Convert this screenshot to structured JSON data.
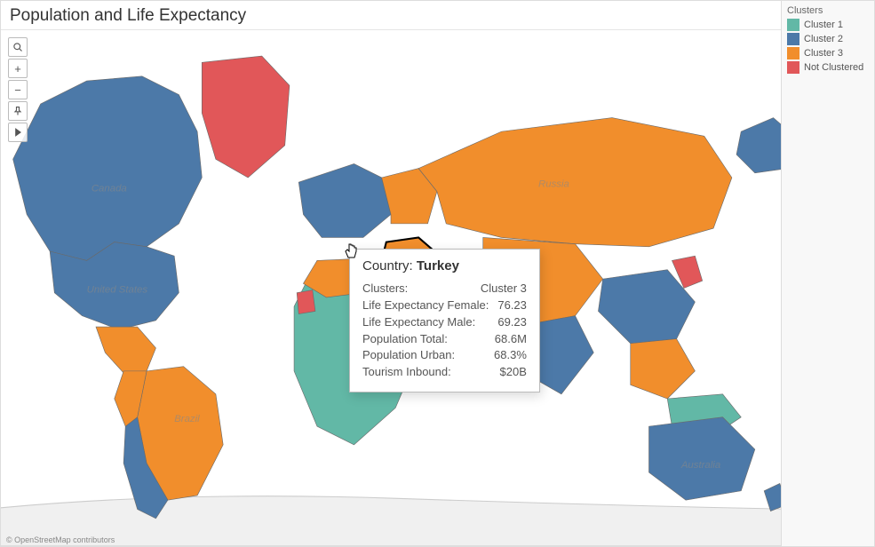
{
  "panel": {
    "title": "Population and Life Expectancy",
    "footer": "© OpenStreetMap contributors"
  },
  "toolbar": {
    "search": "search",
    "zoom_in": "+",
    "zoom_out": "−",
    "pin": "pin",
    "play": "▶"
  },
  "legend": {
    "title": "Clusters",
    "items": [
      {
        "label": "Cluster 1",
        "color": "#62b8a6"
      },
      {
        "label": "Cluster 2",
        "color": "#4c79a8"
      },
      {
        "label": "Cluster 3",
        "color": "#f18e2c"
      },
      {
        "label": "Not Clustered",
        "color": "#e15759"
      }
    ]
  },
  "tooltip": {
    "field_label": "Country:",
    "country": "Turkey",
    "rows": [
      {
        "label": "Clusters:",
        "value": "Cluster 3"
      },
      {
        "label": "Life Expectancy Female:",
        "value": "76.23"
      },
      {
        "label": "Life Expectancy Male:",
        "value": "69.23"
      },
      {
        "label": "Population Total:",
        "value": "68.6M"
      },
      {
        "label": "Population Urban:",
        "value": "68.3%"
      },
      {
        "label": "Tourism Inbound:",
        "value": "$20B"
      }
    ]
  },
  "map_labels": {
    "canada": "Canada",
    "usa": "United States",
    "brazil": "Brazil",
    "russia": "Russia",
    "australia": "Australia"
  },
  "colors": {
    "cluster1": "#62b8a6",
    "cluster2": "#4c79a8",
    "cluster3": "#f18e2c",
    "not_clustered": "#e15759",
    "stroke": "#888",
    "ocean": "#ffffff"
  },
  "chart_data": {
    "type": "map",
    "title": "Population and Life Expectancy",
    "color_field": "Clusters",
    "legend": [
      "Cluster 1",
      "Cluster 2",
      "Cluster 3",
      "Not Clustered"
    ],
    "highlighted_country": {
      "name": "Turkey",
      "cluster": "Cluster 3",
      "life_expectancy_female": 76.23,
      "life_expectancy_male": 69.23,
      "population_total": "68.6M",
      "population_urban": "68.3%",
      "tourism_inbound": "$20B"
    },
    "approx_cluster_coloring_note": "World choropleth: most of Americas/Europe/Oceania blue (Cluster 2); most of Africa teal (Cluster 1); Russia/Turkey/Mexico/Brazil/parts of Asia orange (Cluster 3); Greenland/some states red (Not Clustered)."
  }
}
